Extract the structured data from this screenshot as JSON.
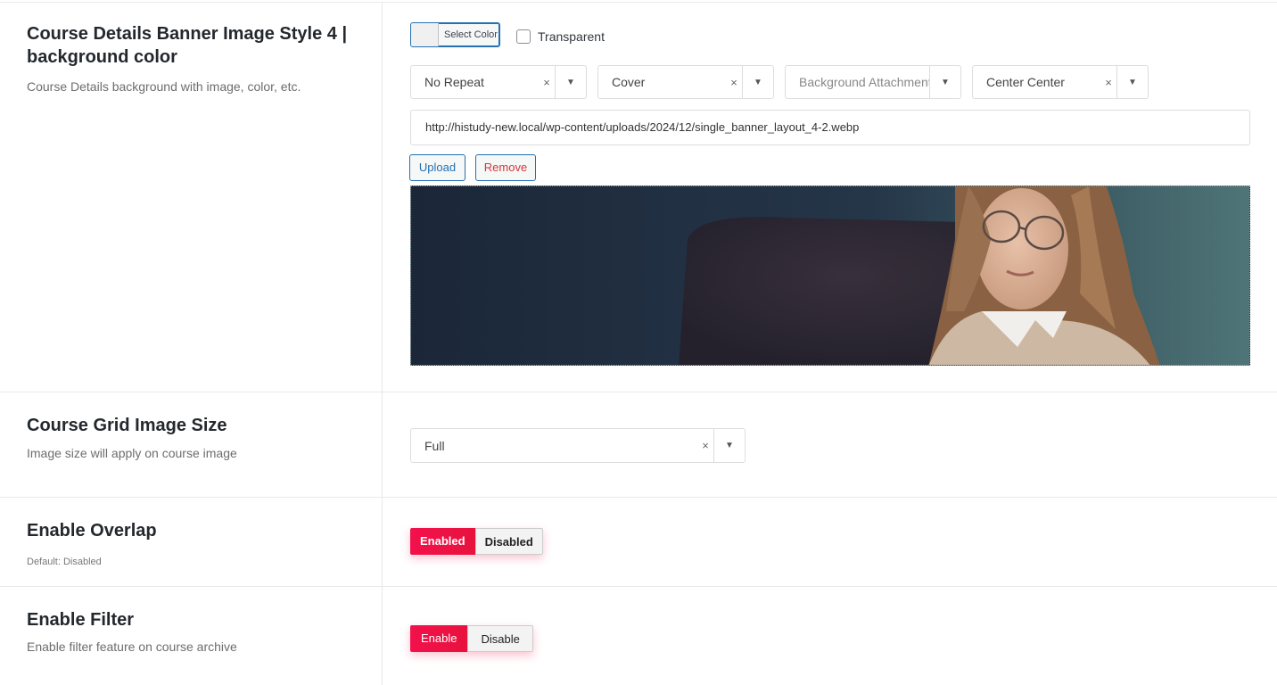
{
  "banner": {
    "title": "Course Details Banner Image Style 4 | background color",
    "description": "Course Details background with image, color, etc.",
    "color_button_label": "Select Color",
    "transparent_label": "Transparent",
    "repeat": {
      "value": "No Repeat",
      "clear": "×"
    },
    "size": {
      "value": "Cover",
      "clear": "×"
    },
    "attachment": {
      "placeholder": "Background Attachment"
    },
    "position": {
      "value": "Center Center",
      "clear": "×"
    },
    "url": "http://histudy-new.local/wp-content/uploads/2024/12/single_banner_layout_4-2.webp",
    "upload_label": "Upload",
    "remove_label": "Remove"
  },
  "grid_image": {
    "title": "Course Grid Image Size",
    "description": "Image size will apply on course image",
    "value": "Full",
    "clear": "×"
  },
  "overlap": {
    "title": "Enable Overlap",
    "description": "Default: Disabled",
    "enabled_label": "Enabled",
    "disabled_label": "Disabled",
    "selected": "Enabled"
  },
  "filter": {
    "title": "Enable Filter",
    "description": "Enable filter feature on course archive",
    "enable_label": "Enable",
    "disable_label": "Disable",
    "selected": "Enable"
  },
  "icons": {
    "dropdown": "chevron-down-icon",
    "clear": "close-icon"
  },
  "colors": {
    "accent": "#f2114c",
    "link": "#2271b1",
    "remove": "#d63638"
  }
}
